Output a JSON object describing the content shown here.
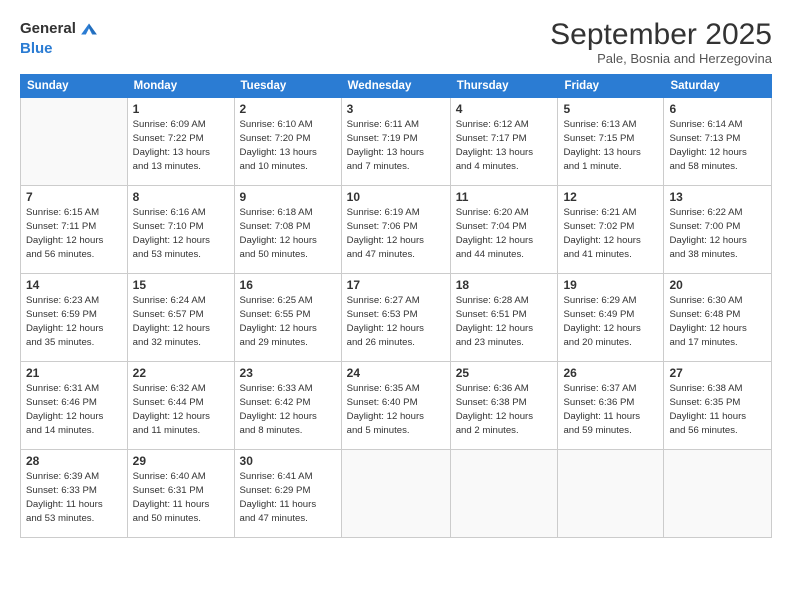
{
  "logo": {
    "line1": "General",
    "line2": "Blue",
    "arrow_color": "#2b7cd3"
  },
  "title": "September 2025",
  "location": "Pale, Bosnia and Herzegovina",
  "weekdays": [
    "Sunday",
    "Monday",
    "Tuesday",
    "Wednesday",
    "Thursday",
    "Friday",
    "Saturday"
  ],
  "weeks": [
    [
      {
        "day": "",
        "info": ""
      },
      {
        "day": "1",
        "info": "Sunrise: 6:09 AM\nSunset: 7:22 PM\nDaylight: 13 hours\nand 13 minutes."
      },
      {
        "day": "2",
        "info": "Sunrise: 6:10 AM\nSunset: 7:20 PM\nDaylight: 13 hours\nand 10 minutes."
      },
      {
        "day": "3",
        "info": "Sunrise: 6:11 AM\nSunset: 7:19 PM\nDaylight: 13 hours\nand 7 minutes."
      },
      {
        "day": "4",
        "info": "Sunrise: 6:12 AM\nSunset: 7:17 PM\nDaylight: 13 hours\nand 4 minutes."
      },
      {
        "day": "5",
        "info": "Sunrise: 6:13 AM\nSunset: 7:15 PM\nDaylight: 13 hours\nand 1 minute."
      },
      {
        "day": "6",
        "info": "Sunrise: 6:14 AM\nSunset: 7:13 PM\nDaylight: 12 hours\nand 58 minutes."
      }
    ],
    [
      {
        "day": "7",
        "info": "Sunrise: 6:15 AM\nSunset: 7:11 PM\nDaylight: 12 hours\nand 56 minutes."
      },
      {
        "day": "8",
        "info": "Sunrise: 6:16 AM\nSunset: 7:10 PM\nDaylight: 12 hours\nand 53 minutes."
      },
      {
        "day": "9",
        "info": "Sunrise: 6:18 AM\nSunset: 7:08 PM\nDaylight: 12 hours\nand 50 minutes."
      },
      {
        "day": "10",
        "info": "Sunrise: 6:19 AM\nSunset: 7:06 PM\nDaylight: 12 hours\nand 47 minutes."
      },
      {
        "day": "11",
        "info": "Sunrise: 6:20 AM\nSunset: 7:04 PM\nDaylight: 12 hours\nand 44 minutes."
      },
      {
        "day": "12",
        "info": "Sunrise: 6:21 AM\nSunset: 7:02 PM\nDaylight: 12 hours\nand 41 minutes."
      },
      {
        "day": "13",
        "info": "Sunrise: 6:22 AM\nSunset: 7:00 PM\nDaylight: 12 hours\nand 38 minutes."
      }
    ],
    [
      {
        "day": "14",
        "info": "Sunrise: 6:23 AM\nSunset: 6:59 PM\nDaylight: 12 hours\nand 35 minutes."
      },
      {
        "day": "15",
        "info": "Sunrise: 6:24 AM\nSunset: 6:57 PM\nDaylight: 12 hours\nand 32 minutes."
      },
      {
        "day": "16",
        "info": "Sunrise: 6:25 AM\nSunset: 6:55 PM\nDaylight: 12 hours\nand 29 minutes."
      },
      {
        "day": "17",
        "info": "Sunrise: 6:27 AM\nSunset: 6:53 PM\nDaylight: 12 hours\nand 26 minutes."
      },
      {
        "day": "18",
        "info": "Sunrise: 6:28 AM\nSunset: 6:51 PM\nDaylight: 12 hours\nand 23 minutes."
      },
      {
        "day": "19",
        "info": "Sunrise: 6:29 AM\nSunset: 6:49 PM\nDaylight: 12 hours\nand 20 minutes."
      },
      {
        "day": "20",
        "info": "Sunrise: 6:30 AM\nSunset: 6:48 PM\nDaylight: 12 hours\nand 17 minutes."
      }
    ],
    [
      {
        "day": "21",
        "info": "Sunrise: 6:31 AM\nSunset: 6:46 PM\nDaylight: 12 hours\nand 14 minutes."
      },
      {
        "day": "22",
        "info": "Sunrise: 6:32 AM\nSunset: 6:44 PM\nDaylight: 12 hours\nand 11 minutes."
      },
      {
        "day": "23",
        "info": "Sunrise: 6:33 AM\nSunset: 6:42 PM\nDaylight: 12 hours\nand 8 minutes."
      },
      {
        "day": "24",
        "info": "Sunrise: 6:35 AM\nSunset: 6:40 PM\nDaylight: 12 hours\nand 5 minutes."
      },
      {
        "day": "25",
        "info": "Sunrise: 6:36 AM\nSunset: 6:38 PM\nDaylight: 12 hours\nand 2 minutes."
      },
      {
        "day": "26",
        "info": "Sunrise: 6:37 AM\nSunset: 6:36 PM\nDaylight: 11 hours\nand 59 minutes."
      },
      {
        "day": "27",
        "info": "Sunrise: 6:38 AM\nSunset: 6:35 PM\nDaylight: 11 hours\nand 56 minutes."
      }
    ],
    [
      {
        "day": "28",
        "info": "Sunrise: 6:39 AM\nSunset: 6:33 PM\nDaylight: 11 hours\nand 53 minutes."
      },
      {
        "day": "29",
        "info": "Sunrise: 6:40 AM\nSunset: 6:31 PM\nDaylight: 11 hours\nand 50 minutes."
      },
      {
        "day": "30",
        "info": "Sunrise: 6:41 AM\nSunset: 6:29 PM\nDaylight: 11 hours\nand 47 minutes."
      },
      {
        "day": "",
        "info": ""
      },
      {
        "day": "",
        "info": ""
      },
      {
        "day": "",
        "info": ""
      },
      {
        "day": "",
        "info": ""
      }
    ]
  ]
}
